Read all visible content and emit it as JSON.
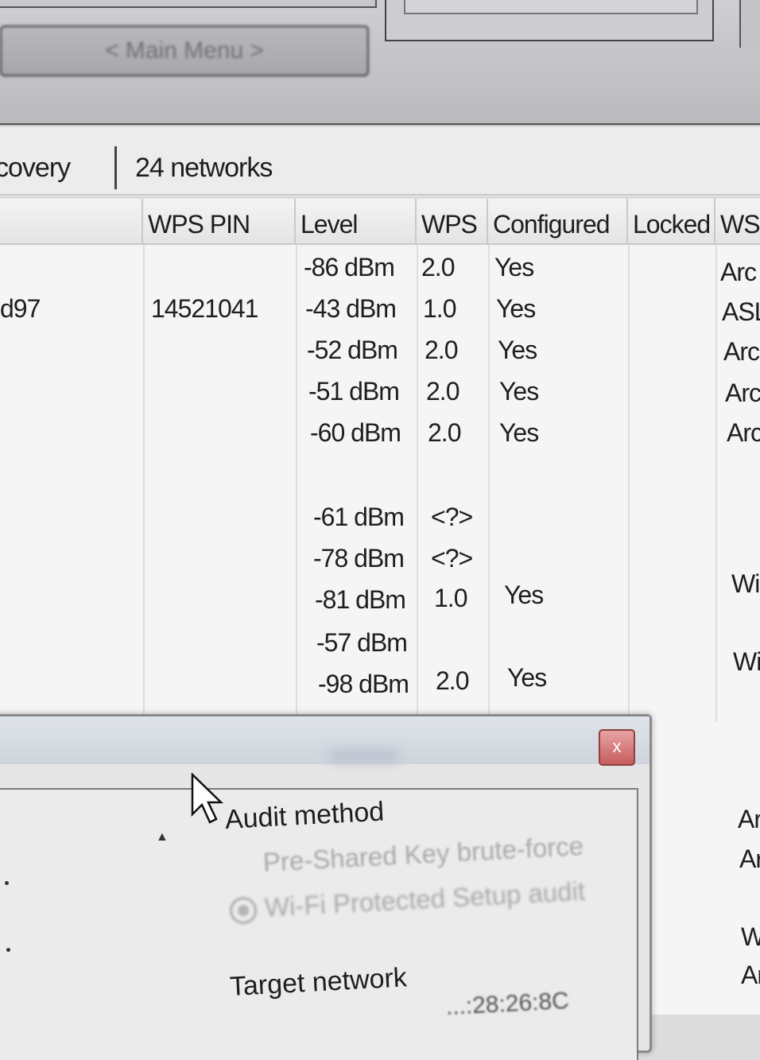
{
  "top": {
    "main_menu_button": "< Main Menu >"
  },
  "status": {
    "mode_fragment": "covery",
    "network_count": "24 networks"
  },
  "table": {
    "columns": [
      "WPS PIN",
      "Level",
      "WPS",
      "Configured",
      "Locked",
      "WSC"
    ],
    "rows": [
      {
        "name": "",
        "pin": "",
        "level": "-86 dBm",
        "wps": "2.0",
        "configured": "Yes",
        "locked": "",
        "wsc": "Arc"
      },
      {
        "name": "d97",
        "pin": "14521041",
        "level": "-43 dBm",
        "wps": "1.0",
        "configured": "Yes",
        "locked": "",
        "wsc": "ASL"
      },
      {
        "name": "",
        "pin": "",
        "level": "-52 dBm",
        "wps": "2.0",
        "configured": "Yes",
        "locked": "",
        "wsc": "Arc"
      },
      {
        "name": "",
        "pin": "",
        "level": "-51 dBm",
        "wps": "2.0",
        "configured": "Yes",
        "locked": "",
        "wsc": "Arc"
      },
      {
        "name": "",
        "pin": "",
        "level": "-60 dBm",
        "wps": "2.0",
        "configured": "Yes",
        "locked": "",
        "wsc": "Arc"
      },
      {
        "name": "",
        "pin": "",
        "level": "-61 dBm",
        "wps": "<?>",
        "configured": "",
        "locked": "",
        "wsc": ""
      },
      {
        "name": "",
        "pin": "",
        "level": "-78 dBm",
        "wps": "<?>",
        "configured": "",
        "locked": "",
        "wsc": ""
      },
      {
        "name": "",
        "pin": "",
        "level": "-81 dBm",
        "wps": "1.0",
        "configured": "Yes",
        "locked": "",
        "wsc": "Wi"
      },
      {
        "name": "",
        "pin": "",
        "level": "-57 dBm",
        "wps": "",
        "configured": "",
        "locked": "",
        "wsc": "Wi"
      },
      {
        "name": "",
        "pin": "",
        "level": "-98 dBm",
        "wps": "2.0",
        "configured": "Yes",
        "locked": "",
        "wsc": ""
      }
    ],
    "right_fragments_below": [
      "Ar",
      "Ar",
      "W",
      "Ar"
    ]
  },
  "dialog": {
    "close_glyph": "x",
    "audit_method_label": "Audit method",
    "option_psk": "Pre-Shared Key brute-force",
    "option_wps": "Wi-Fi Protected Setup audit",
    "target_network_label": "Target network",
    "mac_fragment": "...:28:26:8C"
  }
}
